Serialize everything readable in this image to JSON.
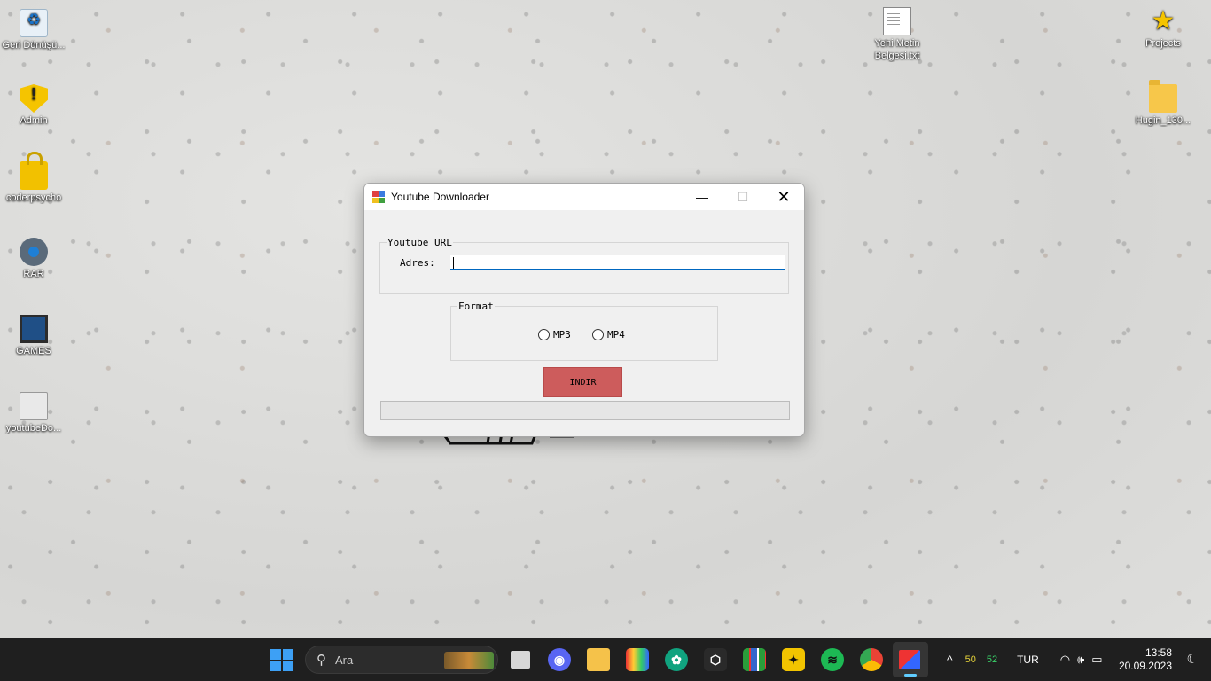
{
  "desktop": {
    "icons_left": [
      {
        "label": "Geri Dönüşü...",
        "icon": "recycle-bin-icon"
      },
      {
        "label": "Admin",
        "icon": "shield-warning-icon"
      },
      {
        "label": "coderpsycho",
        "icon": "lock-icon"
      },
      {
        "label": "RAR",
        "icon": "gear-icon"
      },
      {
        "label": "GAMES",
        "icon": "monitor-icon"
      },
      {
        "label": "youtubeDo...",
        "icon": "drive-icon"
      }
    ],
    "icons_right": [
      {
        "label": "Yeni Metin Belgesi.txt",
        "icon": "text-document-icon"
      },
      {
        "label": "Projects",
        "icon": "star-icon"
      },
      {
        "label": "Hugin_130...",
        "icon": "folder-icon"
      }
    ]
  },
  "window": {
    "title": "Youtube Downloader",
    "controls": {
      "minimize": "—",
      "maximize": "☐",
      "close": "✕"
    },
    "url_group": {
      "legend": "Youtube URL",
      "label": "Adres:",
      "value": "",
      "placeholder": ""
    },
    "format_group": {
      "legend": "Format",
      "options": [
        {
          "label": "MP3",
          "selected": false
        },
        {
          "label": "MP4",
          "selected": false
        }
      ]
    },
    "download_button": "INDIR",
    "progress": 0
  },
  "taskbar": {
    "search_label": "Ara",
    "apps": [
      "task-view-icon",
      "discord-icon",
      "file-explorer-icon",
      "paint-icon",
      "chatgpt-icon",
      "unity-icon",
      "grid-app-icon",
      "framer-icon",
      "spotify-icon",
      "chrome-icon",
      "youtube-downloader-app-icon"
    ],
    "tray": {
      "chevron": "^",
      "cpu": "50",
      "gpu": "52",
      "language": "TUR",
      "time": "13:58",
      "date": "20.09.2023"
    }
  },
  "colors": {
    "download_button": "#cd5c5c",
    "input_focus": "#0067c0",
    "taskbar": "#1f1f1f",
    "cpu_temp": "#e6d33a",
    "gpu_temp": "#3ad46a"
  }
}
